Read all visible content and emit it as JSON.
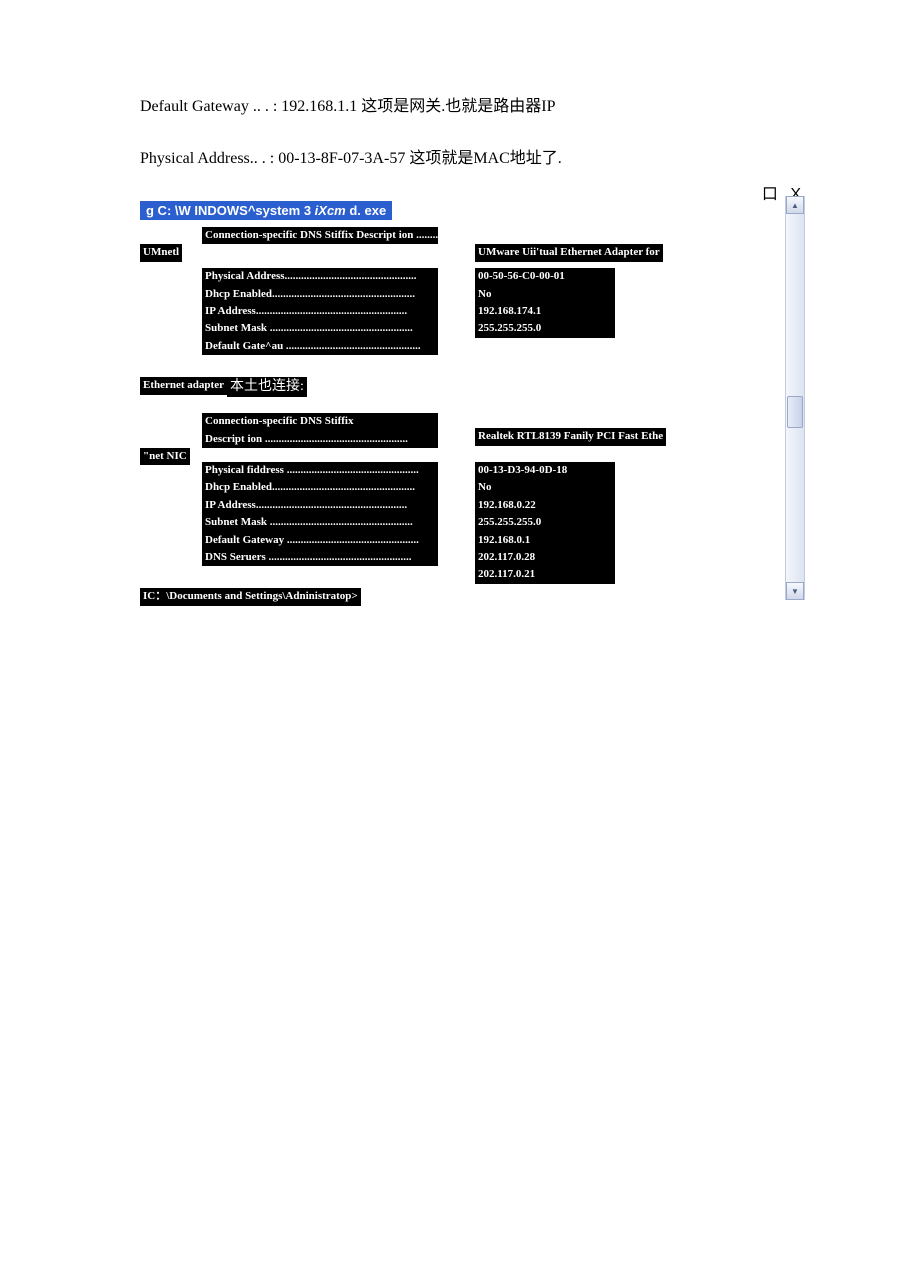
{
  "intro": {
    "line1": "Default Gateway .. . : 192.168.1.1 这项是网关.也就是路由器IP",
    "line2": "Physical Address.. . : 00-13-8F-07-3A-57 这项就是MAC地址了."
  },
  "title": {
    "part1": "g C: \\W INDOWS^system 3 ",
    "italic": "iXcm",
    "part2": " d. exe"
  },
  "window_controls": "口 X",
  "adapter1": {
    "sideLabel": "UMnetl",
    "labels": [
      "Connection-specific DNS Stiffix Descript ion .............",
      "Physical Address................................................",
      "Dhcp Enabled....................................................",
      "IP Address.......................................................",
      "Subnet Mask ....................................................",
      "Default Gate^au ................................................."
    ],
    "header": "UMware Uii'tual Ethernet Adapter for",
    "values": [
      "00-50-56-C0-00-01",
      "No",
      "192.168.174.1",
      "255.255.255.0"
    ]
  },
  "adapterHeader": {
    "prefix": "Ethernet adapter ",
    "cn": "本土也连接:"
  },
  "adapter2": {
    "sideLabel": "\"net NIC",
    "labels": [
      "Connection-specific DNS Stiffix",
      "Descript ion ....................................................",
      "Physical fiddress ................................................",
      "Dhcp Enabled....................................................",
      "IP Address.......................................................",
      "Subnet Mask ....................................................",
      "Default Gateway ................................................",
      "DNS Seruers ...................................................."
    ],
    "header": "Realtek RTL8139 Fanily PCI Fast Ethe",
    "values": [
      "00-13-D3-94-0D-18",
      "No",
      "192.168.0.22",
      "255.255.255.0",
      "192.168.0.1",
      "202.117.0.28",
      "202.117.0.21"
    ]
  },
  "prompt": "IC：\\Documents and Settings\\Adninistratop>"
}
